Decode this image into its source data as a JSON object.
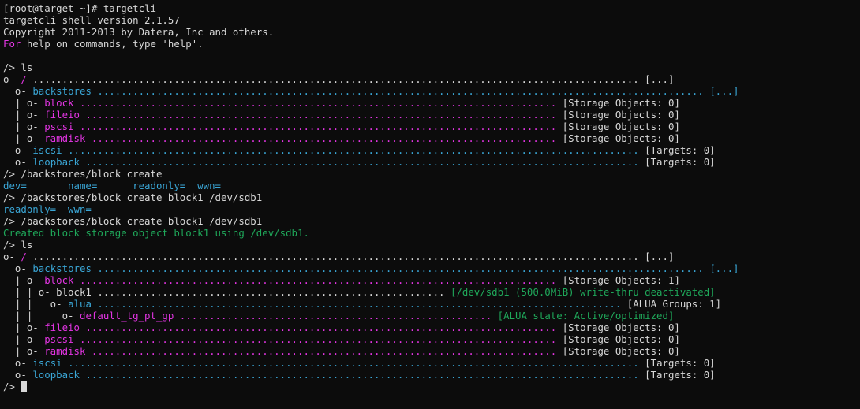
{
  "colors": {
    "default": "#d8d8d8",
    "magenta": "#e335e3",
    "blue": "#3aa6d6",
    "green": "#1fa85a"
  },
  "terminal": {
    "lines": [
      [
        {
          "t": "[root@target ~]# targetcli"
        }
      ],
      [
        {
          "t": "targetcli shell version 2.1.57"
        }
      ],
      [
        {
          "t": "Copyright 2011-2013 by Datera, Inc and others."
        }
      ],
      [
        {
          "t": "For",
          "c": "magenta"
        },
        {
          "t": " help on commands, type 'help'."
        }
      ],
      [
        {
          "t": ""
        }
      ],
      [
        {
          "t": "/> ls"
        }
      ],
      [
        {
          "t": "o- "
        },
        {
          "t": "/",
          "c": "magenta"
        },
        {
          "t": " ....................................................................................................... [...]"
        }
      ],
      [
        {
          "t": "  o- "
        },
        {
          "t": "backstores",
          "c": "blue"
        },
        {
          "t": " ....................................................................................................... [...]",
          "c": "blue"
        }
      ],
      [
        {
          "t": "  | o- "
        },
        {
          "t": "block",
          "c": "magenta"
        },
        {
          "t": " ................................................................................. ",
          "c": "magenta"
        },
        {
          "t": "[Storage Objects: 0]"
        }
      ],
      [
        {
          "t": "  | o- "
        },
        {
          "t": "fileio",
          "c": "magenta"
        },
        {
          "t": " ................................................................................ ",
          "c": "magenta"
        },
        {
          "t": "[Storage Objects: 0]"
        }
      ],
      [
        {
          "t": "  | o- "
        },
        {
          "t": "pscsi",
          "c": "magenta"
        },
        {
          "t": " ................................................................................. ",
          "c": "magenta"
        },
        {
          "t": "[Storage Objects: 0]"
        }
      ],
      [
        {
          "t": "  | o- "
        },
        {
          "t": "ramdisk",
          "c": "magenta"
        },
        {
          "t": " ............................................................................... ",
          "c": "magenta"
        },
        {
          "t": "[Storage Objects: 0]"
        }
      ],
      [
        {
          "t": "  o- "
        },
        {
          "t": "iscsi",
          "c": "blue"
        },
        {
          "t": " ................................................................................................. ",
          "c": "blue"
        },
        {
          "t": "[Targets: 0]"
        }
      ],
      [
        {
          "t": "  o- "
        },
        {
          "t": "loopback",
          "c": "blue"
        },
        {
          "t": " .............................................................................................. ",
          "c": "blue"
        },
        {
          "t": "[Targets: 0]"
        }
      ],
      [
        {
          "t": "/> /backstores/block create"
        }
      ],
      [
        {
          "t": "dev=       name=      readonly=  wwn=",
          "c": "blue"
        }
      ],
      [
        {
          "t": "/> /backstores/block create block1 /dev/sdb1"
        }
      ],
      [
        {
          "t": "readonly=  wwn=",
          "c": "blue"
        }
      ],
      [
        {
          "t": "/> /backstores/block create block1 /dev/sdb1"
        }
      ],
      [
        {
          "t": "Created block storage object block1 using /dev/sdb1.",
          "c": "green"
        }
      ],
      [
        {
          "t": "/> ls"
        }
      ],
      [
        {
          "t": "o- "
        },
        {
          "t": "/",
          "c": "magenta"
        },
        {
          "t": " ....................................................................................................... [...]"
        }
      ],
      [
        {
          "t": "  o- "
        },
        {
          "t": "backstores",
          "c": "blue"
        },
        {
          "t": " ....................................................................................................... [...]",
          "c": "blue"
        }
      ],
      [
        {
          "t": "  | o- "
        },
        {
          "t": "block",
          "c": "magenta"
        },
        {
          "t": " ................................................................................. ",
          "c": "magenta"
        },
        {
          "t": "[Storage Objects: 1]"
        }
      ],
      [
        {
          "t": "  | | o- block1 ........................................................... "
        },
        {
          "t": "[/dev/sdb1 (500.0MiB) write-thru deactivated]",
          "c": "green"
        }
      ],
      [
        {
          "t": "  | |   o- "
        },
        {
          "t": "alua",
          "c": "blue"
        },
        {
          "t": " ......................................................................................... ",
          "c": "blue"
        },
        {
          "t": "[ALUA Groups: 1]"
        }
      ],
      [
        {
          "t": "  | |     o- "
        },
        {
          "t": "default_tg_pt_gp",
          "c": "magenta"
        },
        {
          "t": " ..................................................... ",
          "c": "magenta"
        },
        {
          "t": "[ALUA state: Active/optimized]",
          "c": "green"
        }
      ],
      [
        {
          "t": "  | o- "
        },
        {
          "t": "fileio",
          "c": "magenta"
        },
        {
          "t": " ................................................................................ ",
          "c": "magenta"
        },
        {
          "t": "[Storage Objects: 0]"
        }
      ],
      [
        {
          "t": "  | o- "
        },
        {
          "t": "pscsi",
          "c": "magenta"
        },
        {
          "t": " ................................................................................. ",
          "c": "magenta"
        },
        {
          "t": "[Storage Objects: 0]"
        }
      ],
      [
        {
          "t": "  | o- "
        },
        {
          "t": "ramdisk",
          "c": "magenta"
        },
        {
          "t": " ............................................................................... ",
          "c": "magenta"
        },
        {
          "t": "[Storage Objects: 0]"
        }
      ],
      [
        {
          "t": "  o- "
        },
        {
          "t": "iscsi",
          "c": "blue"
        },
        {
          "t": " ................................................................................................. ",
          "c": "blue"
        },
        {
          "t": "[Targets: 0]"
        }
      ],
      [
        {
          "t": "  o- "
        },
        {
          "t": "loopback",
          "c": "blue"
        },
        {
          "t": " .............................................................................................. ",
          "c": "blue"
        },
        {
          "t": "[Targets: 0]"
        }
      ],
      [
        {
          "t": "/> "
        }
      ]
    ]
  }
}
